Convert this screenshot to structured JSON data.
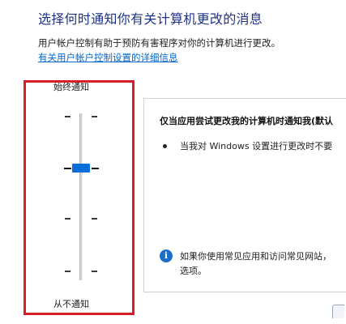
{
  "header": {
    "title": "选择何时通知你有关计算机更改的消息",
    "description": "用户帐户控制有助于预防有害程序对你的计算机进行更改。",
    "link": "有关用户帐户控制设置的详细信息"
  },
  "slider": {
    "top_label": "始终通知",
    "bottom_label": "从不通知",
    "level_index": 1,
    "levels_count": 4
  },
  "panel": {
    "title": "仅当应用尝试更改我的计算机时通知我(默认",
    "bullet": "当我对 Windows 设置进行更改时不要",
    "info_line1": "如果你使用常见应用和访问常见网站，",
    "info_line2": "选项。",
    "info_icon": "info-icon"
  },
  "colors": {
    "heading": "#1e3287",
    "link": "#0066cc",
    "thumb": "#0a6fd8",
    "highlight": "#d91e26"
  }
}
